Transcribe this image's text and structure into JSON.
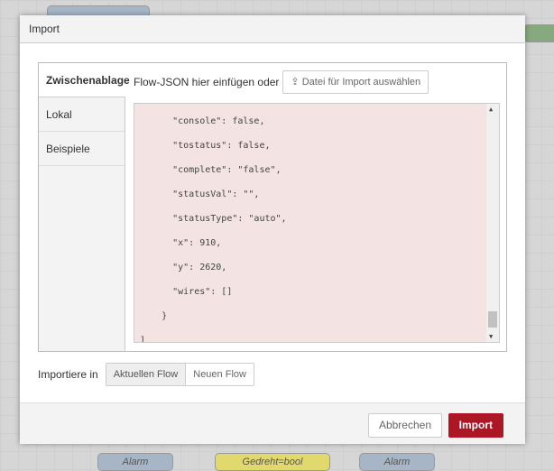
{
  "dialog": {
    "title": "Import"
  },
  "tabs": [
    "Zwischenablage",
    "Lokal",
    "Beispiele"
  ],
  "hint": "Flow-JSON hier einfügen oder",
  "file_button": "Datei für Import auswählen",
  "json_text": "      \"console\": false,\n      \"tostatus\": false,\n      \"complete\": \"false\",\n      \"statusVal\": \"\",\n      \"statusType\": \"auto\",\n      \"x\": 910,\n      \"y\": 2620,\n      \"wires\": []\n    }\n]",
  "import_into": {
    "label": "Importiere in",
    "options": [
      "Aktuellen Flow",
      "Neuen Flow"
    ],
    "selected": "Aktuellen Flow"
  },
  "footer": {
    "cancel": "Abbrechen",
    "import": "Import"
  },
  "background_nodes": [
    "Alarm",
    "Gedreht=bool",
    "Alarm"
  ],
  "colors": {
    "primary": "#ad1625",
    "textarea_bg": "#f3e4e3"
  }
}
